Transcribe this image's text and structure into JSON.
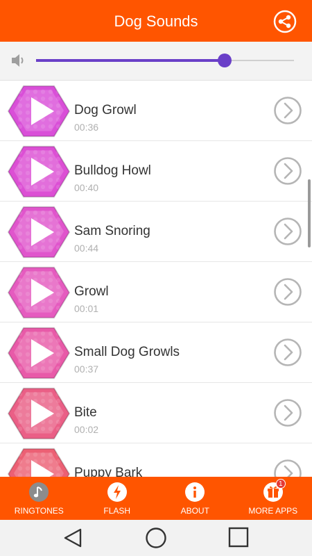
{
  "appbar": {
    "title": "Dog Sounds",
    "share_icon": "share-icon"
  },
  "volume": {
    "icon": "speaker-icon",
    "level_percent": 73,
    "track_color": "#6a3fc8"
  },
  "sounds": [
    {
      "name": "Dog Growl",
      "duration": "00:36",
      "color": "#d94fd8"
    },
    {
      "name": "Bulldog Howl",
      "duration": "00:40",
      "color": "#dc4fd4"
    },
    {
      "name": "Sam Snoring",
      "duration": "00:44",
      "color": "#e055cc"
    },
    {
      "name": "Growl",
      "duration": "00:01",
      "color": "#e55bbf"
    },
    {
      "name": "Small Dog Growls",
      "duration": "00:37",
      "color": "#e85aa8"
    },
    {
      "name": "Bite",
      "duration": "00:02",
      "color": "#ea5f86"
    },
    {
      "name": "Puppy Bark",
      "duration": "",
      "color": "#ec6074"
    }
  ],
  "bottom_nav": [
    {
      "label": "RINGTONES",
      "icon": "music-note-icon"
    },
    {
      "label": "FLASH",
      "icon": "flash-icon"
    },
    {
      "label": "ABOUT",
      "icon": "info-icon"
    },
    {
      "label": "MORE APPS",
      "icon": "gift-icon",
      "badge": "1"
    }
  ],
  "colors": {
    "primary": "#ff5500",
    "accent": "#6a3fc8"
  }
}
